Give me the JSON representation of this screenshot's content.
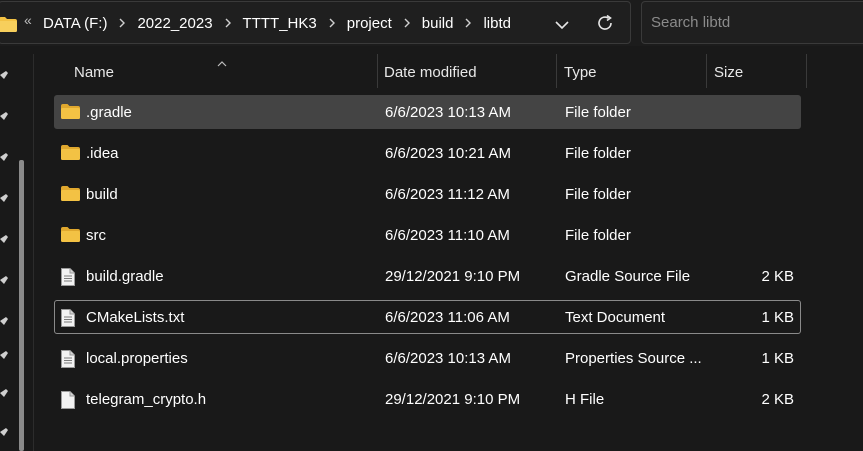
{
  "breadcrumb": {
    "overflow": "«",
    "items": [
      "DATA (F:)",
      "2022_2023",
      "TTTT_HK3",
      "project",
      "build",
      "libtd"
    ]
  },
  "search": {
    "placeholder": "Search libtd"
  },
  "columns": {
    "name": "Name",
    "date": "Date modified",
    "type": "Type",
    "size": "Size"
  },
  "files": [
    {
      "name": ".gradle",
      "date": "6/6/2023 10:13 AM",
      "type": "File folder",
      "size": "",
      "icon": "folder-icon",
      "selected": true,
      "focused": false
    },
    {
      "name": ".idea",
      "date": "6/6/2023 10:21 AM",
      "type": "File folder",
      "size": "",
      "icon": "folder-icon",
      "selected": false,
      "focused": false
    },
    {
      "name": "build",
      "date": "6/6/2023 11:12 AM",
      "type": "File folder",
      "size": "",
      "icon": "folder-icon",
      "selected": false,
      "focused": false
    },
    {
      "name": "src",
      "date": "6/6/2023 11:10 AM",
      "type": "File folder",
      "size": "",
      "icon": "folder-icon",
      "selected": false,
      "focused": false
    },
    {
      "name": "build.gradle",
      "date": "29/12/2021 9:10 PM",
      "type": "Gradle Source File",
      "size": "2 KB",
      "icon": "text-file-icon",
      "selected": false,
      "focused": false
    },
    {
      "name": "CMakeLists.txt",
      "date": "6/6/2023 11:06 AM",
      "type": "Text Document",
      "size": "1 KB",
      "icon": "text-file-icon",
      "selected": false,
      "focused": true
    },
    {
      "name": "local.properties",
      "date": "6/6/2023 10:13 AM",
      "type": "Properties Source ...",
      "size": "1 KB",
      "icon": "text-file-icon",
      "selected": false,
      "focused": false
    },
    {
      "name": "telegram_crypto.h",
      "date": "29/12/2021 9:10 PM",
      "type": "H File",
      "size": "2 KB",
      "icon": "blank-file-icon",
      "selected": false,
      "focused": false
    }
  ],
  "colors": {
    "background": "#191919",
    "selected_row": "#444444",
    "folder": "#f3c244",
    "text": "#ffffff"
  }
}
